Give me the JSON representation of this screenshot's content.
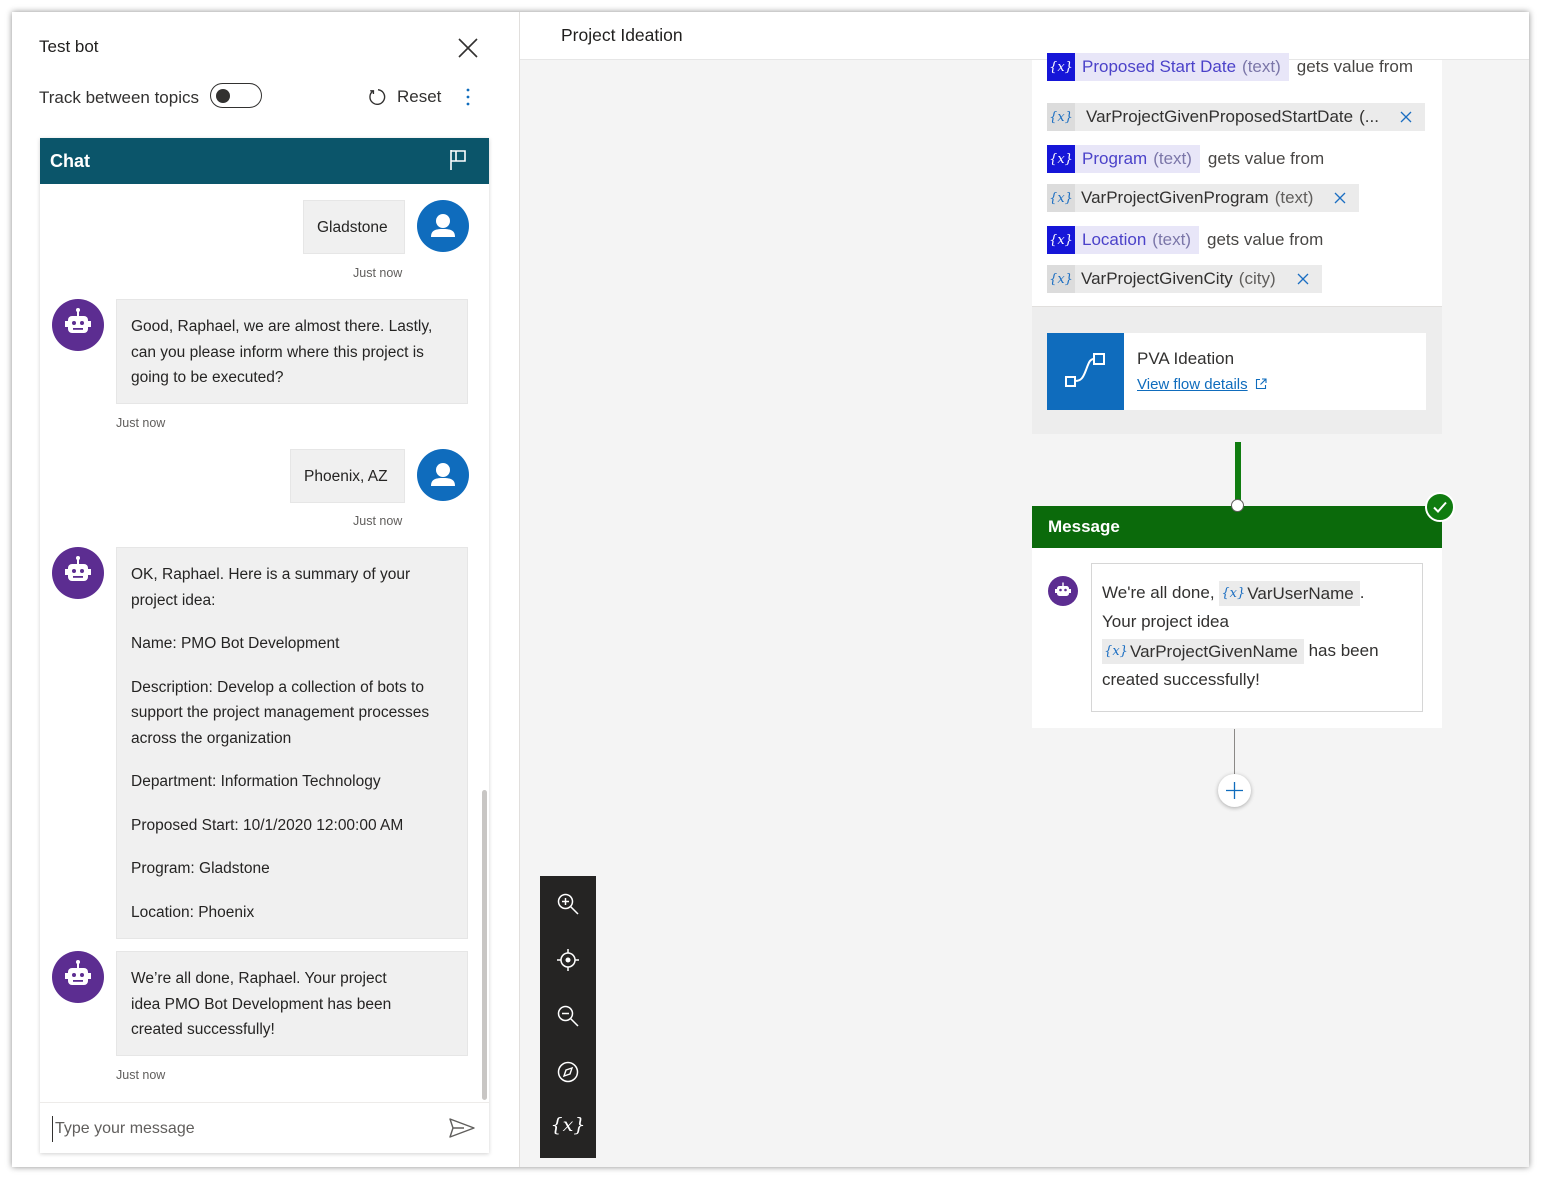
{
  "test_bot": {
    "title": "Test bot",
    "track_label": "Track between topics",
    "track_enabled": false,
    "reset_label": "Reset"
  },
  "chat": {
    "header": "Chat",
    "messages": [
      {
        "from": "user",
        "text": "Gladstone",
        "time": "Just now"
      },
      {
        "from": "bot",
        "paragraphs": [
          "Good, Raphael, we are almost there. Lastly, can you please inform where this project is going to be executed?"
        ],
        "time": "Just now"
      },
      {
        "from": "user",
        "text": "Phoenix, AZ",
        "time": "Just now"
      },
      {
        "from": "bot",
        "paragraphs": [
          "OK, Raphael. Here is a summary of your project idea:",
          "Name: PMO Bot Development",
          "Description: Develop a collection of bots to support the project management processes across the organization",
          "Department: Information Technology",
          "Proposed Start: 10/1/2020 12:00:00 AM",
          "Program: Gladstone",
          "Location: Phoenix"
        ]
      },
      {
        "from": "bot",
        "paragraphs": [
          "We’re all done, Raphael. Your project idea PMO Bot Development has been created successfully!"
        ],
        "time": "Just now"
      }
    ],
    "input_placeholder": "Type your message"
  },
  "canvas": {
    "title": "Project Ideation",
    "var_badge": "{x}",
    "gets_value_from": "gets value from",
    "mappings": [
      {
        "target": "Proposed Start Date",
        "target_type": "(text)",
        "source": "VarProjectGivenProposedStartDate",
        "source_type": "(..."
      },
      {
        "target": "Program",
        "target_type": "(text)",
        "source": "VarProjectGivenProgram",
        "source_type": "(text)"
      },
      {
        "target": "Location",
        "target_type": "(text)",
        "source": "VarProjectGivenCity",
        "source_type": "(city)"
      }
    ],
    "flow": {
      "name": "PVA Ideation",
      "link": "View flow details"
    },
    "message_node": {
      "title": "Message",
      "text_1": "We're all done,",
      "var_1": "VarUserName",
      "text_2": ".",
      "text_3": "Your project idea",
      "var_2": "VarProjectGivenName",
      "text_4": "has been",
      "text_5": "created successfully!"
    },
    "toolbar": {
      "variables_label": "{x}"
    }
  },
  "colors": {
    "chat_header": "#0b556a",
    "message_header": "#0b6a0b",
    "connector": "#107c10",
    "user_avatar": "#0f6cbd",
    "bot_avatar": "#5c2d91",
    "variable_badge": "#1616d8"
  },
  "icons": [
    "close-icon",
    "refresh-icon",
    "more-vertical-icon",
    "flag-icon",
    "user-icon",
    "bot-icon",
    "send-icon",
    "variable-icon",
    "dismiss-icon",
    "flow-icon",
    "external-link-icon",
    "checkmark-icon",
    "add-icon",
    "zoom-in-icon",
    "recenter-icon",
    "zoom-out-icon",
    "minimap-icon"
  ]
}
